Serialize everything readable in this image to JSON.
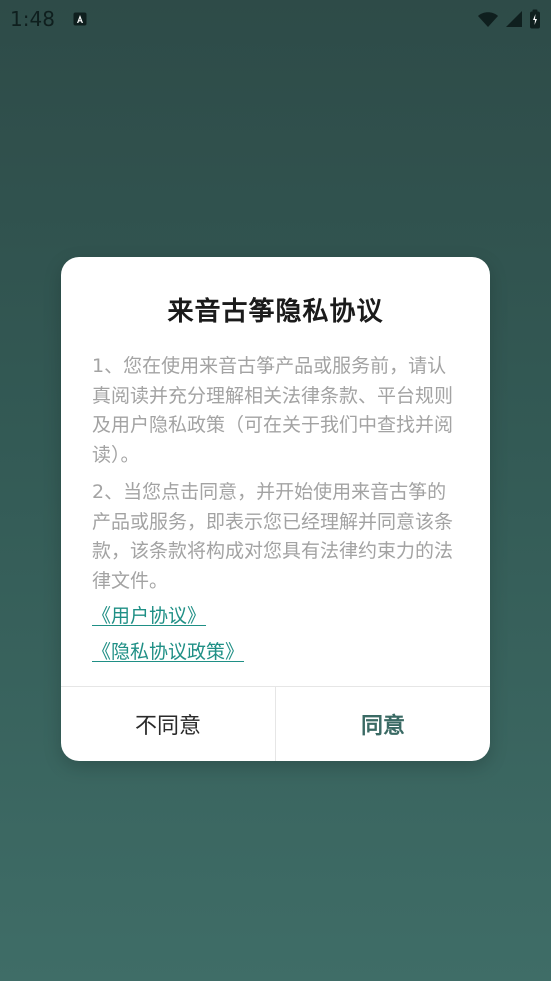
{
  "status_bar": {
    "time": "1:48",
    "icons": [
      "notification-a-icon",
      "wifi-icon",
      "signal-icon",
      "battery-icon"
    ],
    "colors": {
      "icon": "#0f1f1e"
    }
  },
  "dialog": {
    "title": "来音古筝隐私协议",
    "paragraphs": [
      "1、您在使用来音古筝产品或服务前，请认真阅读并充分理解相关法律条款、平台规则及用户隐私政策（可在关于我们中查找并阅读）。",
      "2、当您点击同意，并开始使用来音古筝的产品或服务，即表示您已经理解并同意该条款，该条款将构成对您具有法律约束力的法律文件。"
    ],
    "links": {
      "user_agreement": "《用户协议》",
      "privacy_policy": "《隐私协议政策》"
    },
    "buttons": {
      "disagree": "不同意",
      "agree": "同意"
    },
    "colors": {
      "link": "#1f8f85",
      "agree": "#3a6a64",
      "body_text": "#a3a3a3"
    }
  }
}
